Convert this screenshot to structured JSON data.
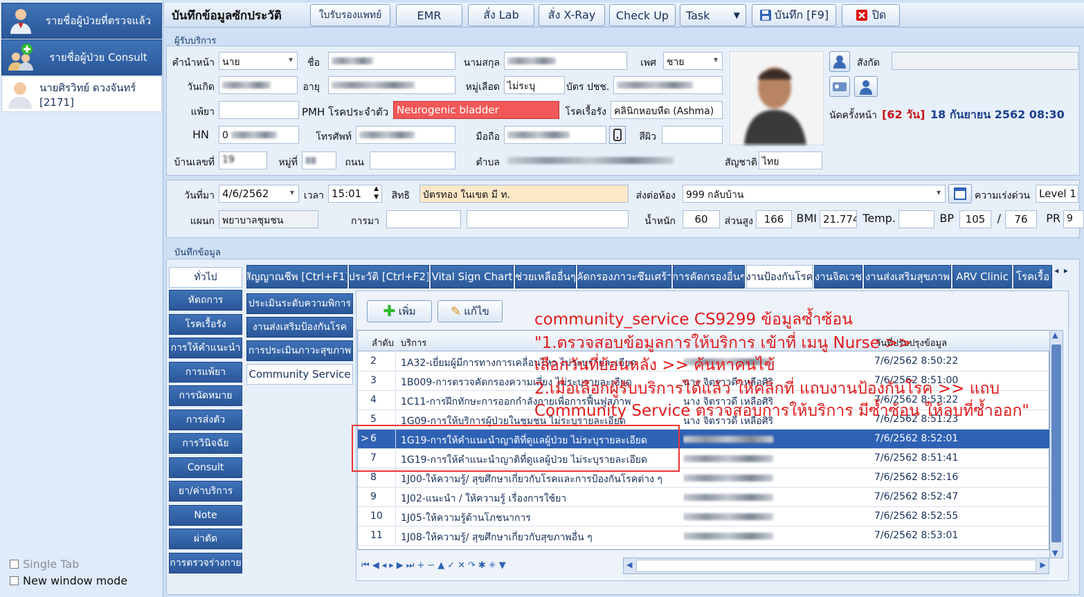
{
  "left": {
    "btn1": "รายชื่อผู้ป่วยที่ตรวจแล้ว",
    "btn2": "รายชื่อผู้ป่วย Consult",
    "patient": "นายศิรวิทย์ ดวงจันทร์ [2171]",
    "single_tab": "Single Tab",
    "new_window": "New window mode"
  },
  "toolbar": {
    "title": "บันทึกข้อมูลซักประวัติ",
    "btn_cert": "ใบรับรองแพทย์",
    "btn_emr": "EMR",
    "btn_lab": "สั่ง Lab",
    "btn_xray": "สั่ง X-Ray",
    "btn_checkup": "Check Up",
    "btn_task": "Task",
    "btn_save": "บันทึก [F9]",
    "btn_close": "ปิด"
  },
  "patient": {
    "section": "ผู้รับบริการ",
    "prefix_label": "คำนำหน้า",
    "prefix": "นาย",
    "name_label": "ชื่อ",
    "surname_label": "นามสกุล",
    "sex_label": "เพศ",
    "sex": "ชาย",
    "dept_label": "สังกัด",
    "dob_label": "วันเกิด",
    "age_label": "อายุ",
    "blood_label": "หมู่เลือด",
    "blood": "ไม่ระบุ",
    "cid_label": "บัตร ปชช.",
    "allergy_label": "แพ้ยา",
    "pmh_label": "PMH โรคประจำตัว",
    "pmh": "Neurogenic bladder",
    "chronic_label": "โรคเรื้อรัง",
    "chronic": "คลินิกหอบหืด (Ashma)",
    "hn_label": "HN",
    "hn_prefix": "0",
    "phone_label": "โทรศัพท์",
    "mobile_label": "มือถือ",
    "skin_label": "สีผิว",
    "house_label": "บ้านเลขที่",
    "house_no": "19",
    "moo_label": "หมู่ที่",
    "road_label": "ถนน",
    "tambon_label": "ตำบล",
    "nation_label": "สัญชาติ",
    "nation": "ไทย",
    "appt_label": "นัดครั้งหน้า",
    "appt_days": "[62 วัน]",
    "appt_date": "18 กันยายน 2562 08:30"
  },
  "visit": {
    "date_label": "วันที่มา",
    "date": "4/6/2562",
    "time_label": "เวลา",
    "time": "15:01",
    "right_label": "สิทธิ",
    "right": "บัตรทอง ในเขต มี ท.",
    "send_label": "ส่งต่อห้อง",
    "send": "999 กลับบ้าน",
    "urgency_label": "ความเร่งด่วน",
    "urgency": "Level 1",
    "ward_label": "แผนก",
    "ward": "พยาบาลชุมชน",
    "came_label": "การมา",
    "weight_label": "น้ำหนัก",
    "weight": "60",
    "height_label": "ส่วนสูง",
    "height": "166",
    "bmi_label": "BMI",
    "bmi": "21.774",
    "temp_label": "Temp.",
    "bp_label": "BP",
    "bp_sys": "105",
    "bp_sep": "/",
    "bp_dia": "76",
    "pr_label": "PR",
    "pr_cut": "9"
  },
  "record": {
    "section": "บันทึกข้อมูล",
    "nav": [
      "ทั่วไป",
      "หัตถการ",
      "โรคเรื้อรัง",
      "การให้คำแนะนำ",
      "การแพ้ยา",
      "การนัดหมาย",
      "การส่งตัว",
      "การวินิจฉัย",
      "Consult",
      "ยา/ค่าบริการ",
      "Note",
      "ผ่าตัด",
      "การตรวจร่างกาย"
    ],
    "tabs": [
      "สัญญาณชีพ [Ctrl+F1]",
      "ประวัติ [Ctrl+F2]",
      "Vital Sign Chart",
      "ช่วยเหลืออื่นๆ",
      "คัดกรองภาวะซึมเศร้า",
      "การคัดกรองอื่นๆ",
      "งานป้องกันโรค",
      "งานจิตเวช",
      "งานส่งเสริมสุขภาพ",
      "ARV Clinic",
      "โรคเรื้อ"
    ],
    "subtabs": [
      "ประเมินระดับความพิการ",
      "งานส่งเสริมป้องกันโรค",
      "การประเมินภาวะสุขภาพ",
      "Community Service"
    ],
    "add": "เพิ่ม",
    "edit": "แก้ไข",
    "headers": {
      "no": "ลำดับ",
      "service": "บริการ",
      "updated": "วันที่ปรับปรุงข้อมูล"
    },
    "rows": [
      {
        "no": "2",
        "service": "1A32-เยี่ยมผู้มีการทางการเคลื่อนไหว ไม่ระบุรายละเอียด",
        "staff": "",
        "time": "7/6/2562 8:50:22"
      },
      {
        "no": "3",
        "service": "1B009-การตรวจคัดกรองความเสี่ยง ไม่ระบุรายละเอียด",
        "staff": "นาง จิตราวดี เหลือศิริ",
        "time": "7/6/2562 8:51:00"
      },
      {
        "no": "4",
        "service": "1C11-การฝึกทักษะการออกกำลังกายเพื่อการฟื้นฟูสภาพ",
        "staff": "นาง จิตราวดี เหลือศิริ",
        "time": "7/6/2562 8:53:22"
      },
      {
        "no": "5",
        "service": "1G09-การให้บริการผู้ป่วยในชุมชน ไม่ระบุรายละเอียด",
        "staff": "นาง จิตราวดี เหลือศิริ",
        "time": "7/6/2562 8:51:23"
      },
      {
        "no": "6",
        "service": "1G19-การให้คำแนะนำญาติที่ดูแลผู้ป่วย ไม่ระบุรายละเอียด",
        "staff": "",
        "time": "7/6/2562 8:52:01"
      },
      {
        "no": "7",
        "service": "1G19-การให้คำแนะนำญาติที่ดูแลผู้ป่วย ไม่ระบุรายละเอียด",
        "staff": "",
        "time": "7/6/2562 8:51:41"
      },
      {
        "no": "8",
        "service": "1J00-ให้ความรู้/ สุขศึกษาเกี่ยวกับโรคและการป้องกันโรคต่าง ๆ",
        "staff": "",
        "time": "7/6/2562 8:52:16"
      },
      {
        "no": "9",
        "service": "1J02-แนะนำ / ให้ความรู้ เรื่องการใช้ยา",
        "staff": "",
        "time": "7/6/2562 8:52:47"
      },
      {
        "no": "10",
        "service": "1J05-ให้ความรู้ด้านโภชนาการ",
        "staff": "",
        "time": "7/6/2562 8:52:55"
      },
      {
        "no": "11",
        "service": "1J08-ให้ความรู้/ สุขศึกษาเกี่ยวกับสุขภาพอื่น ๆ",
        "staff": "",
        "time": "7/6/2562 8:53:01"
      }
    ]
  },
  "annotation": {
    "line1": "community_service  CS9299          ข้อมูลซ้ำซ้อน",
    "line2": "\"1.ตรวจสอบข้อมูลการให้บริการ  เข้าที่ เมนู Nurse >>",
    "line3": "เลือกวันที่ย้อนหลัง >> ค้นหาคนไข้",
    "line4": "2.เมื่อเลือกผู้รับบริการได้แล้ว ให้คลิกที่ แถบงานป้องกันโรค >> แถบ",
    "line5": "Community Service ตรวจสอบการให้บริการ มีซ้ำซ้อน ให้ลบที่ซ้ำออก\""
  },
  "colors": {
    "accent": "#2f62b5",
    "pmh_bg": "#f35858",
    "annotation": "#e11b1b",
    "appt": "#c51515"
  }
}
